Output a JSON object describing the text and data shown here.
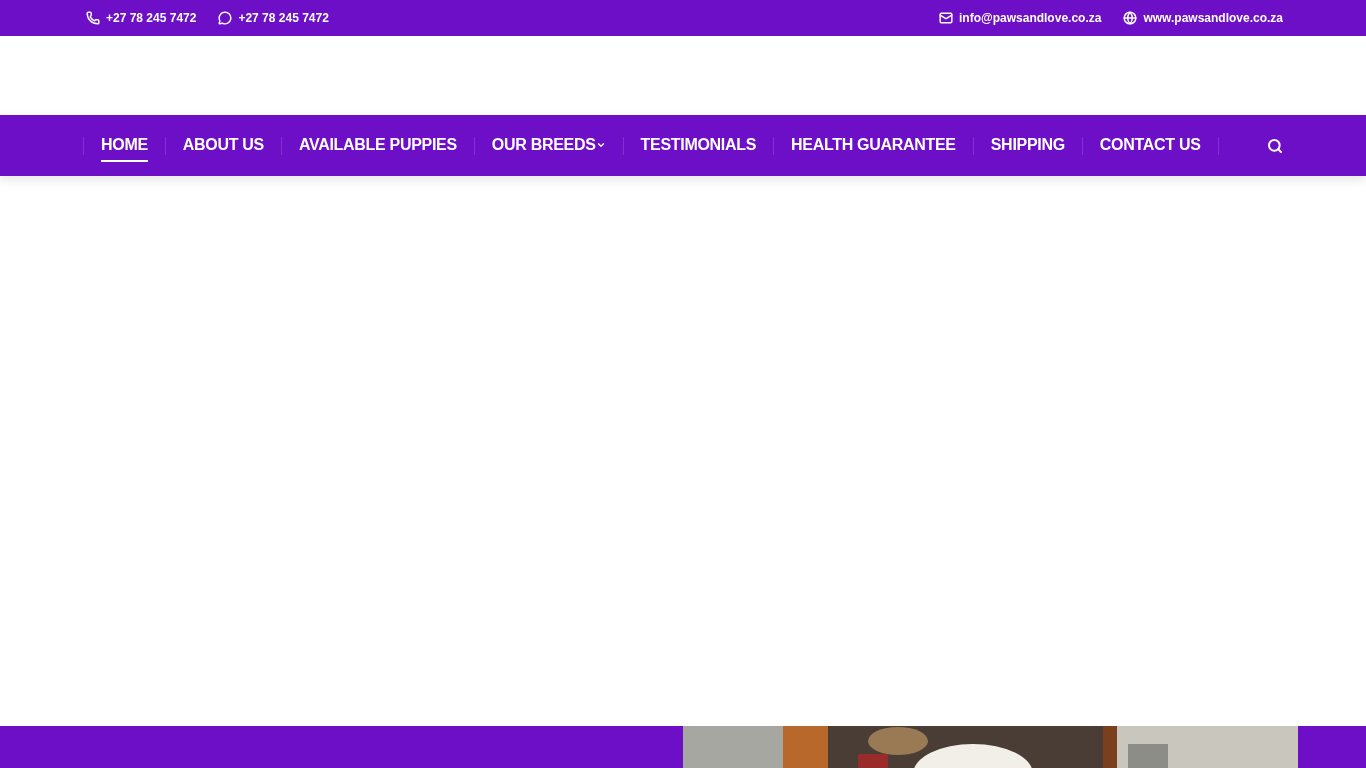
{
  "top_bar": {
    "left": [
      {
        "kind": "phone",
        "text": "+27 78 245 7472"
      },
      {
        "kind": "whatsapp",
        "text": "+27 78 245 7472"
      }
    ],
    "right": [
      {
        "kind": "email",
        "text": "info@pawsandlove.co.za"
      },
      {
        "kind": "web",
        "text": "www.pawsandlove.co.za"
      }
    ]
  },
  "nav": {
    "items": [
      {
        "label": "HOME",
        "selected": true,
        "has_dropdown": false
      },
      {
        "label": "ABOUT US",
        "selected": false,
        "has_dropdown": false
      },
      {
        "label": "AVAILABLE PUPPIES",
        "selected": false,
        "has_dropdown": false
      },
      {
        "label": "OUR BREEDS",
        "selected": false,
        "has_dropdown": true
      },
      {
        "label": "TESTIMONIALS",
        "selected": false,
        "has_dropdown": false
      },
      {
        "label": "HEALTH GUARANTEE",
        "selected": false,
        "has_dropdown": false
      },
      {
        "label": "SHIPPING",
        "selected": false,
        "has_dropdown": false
      },
      {
        "label": "CONTACT US",
        "selected": false,
        "has_dropdown": false
      }
    ]
  }
}
